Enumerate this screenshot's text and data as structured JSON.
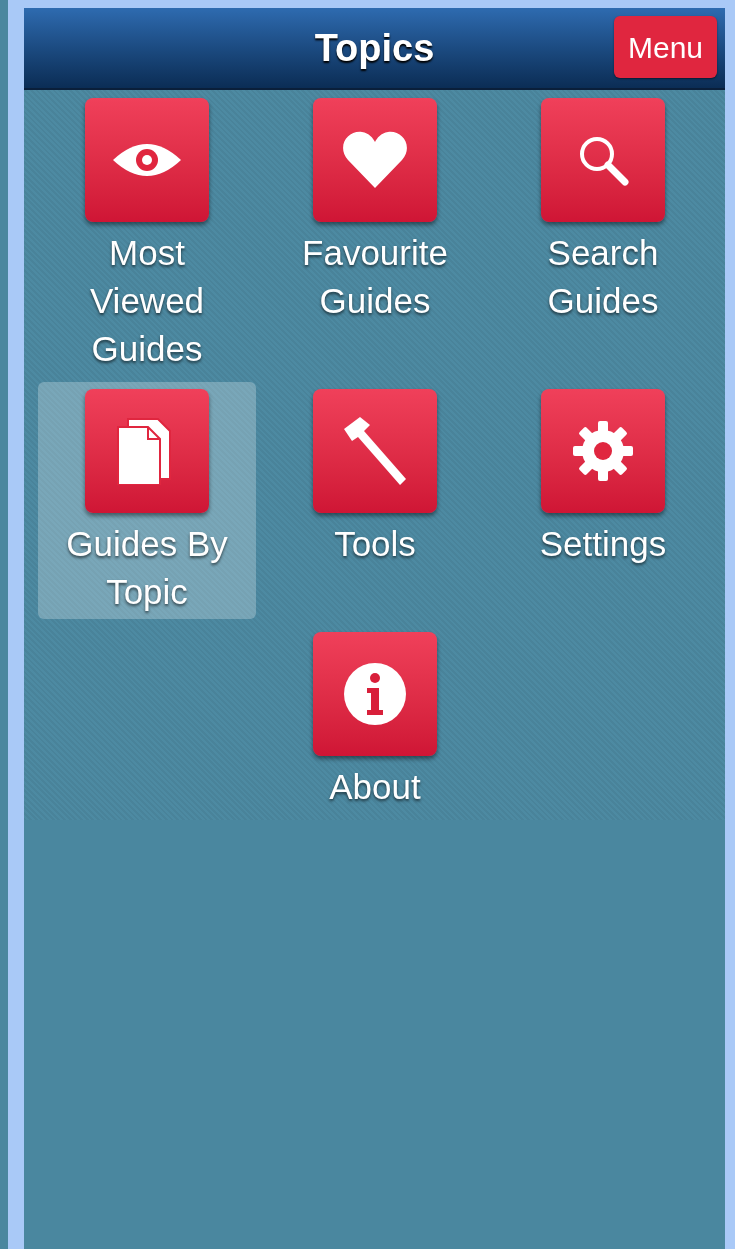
{
  "header": {
    "title": "Topics",
    "menu_button": "Menu"
  },
  "tiles": [
    {
      "label": "Most Viewed Guides",
      "kind": "eye",
      "selected": false
    },
    {
      "label": "Favourite Guides",
      "kind": "heart",
      "selected": false
    },
    {
      "label": "Search Guides",
      "kind": "search",
      "selected": false
    },
    {
      "label": "Guides By Topic",
      "kind": "documents",
      "selected": true
    },
    {
      "label": "Tools",
      "kind": "hammer",
      "selected": false
    },
    {
      "label": "Settings",
      "kind": "gear",
      "selected": false
    },
    {
      "label": "About",
      "kind": "info",
      "selected": false
    }
  ]
}
